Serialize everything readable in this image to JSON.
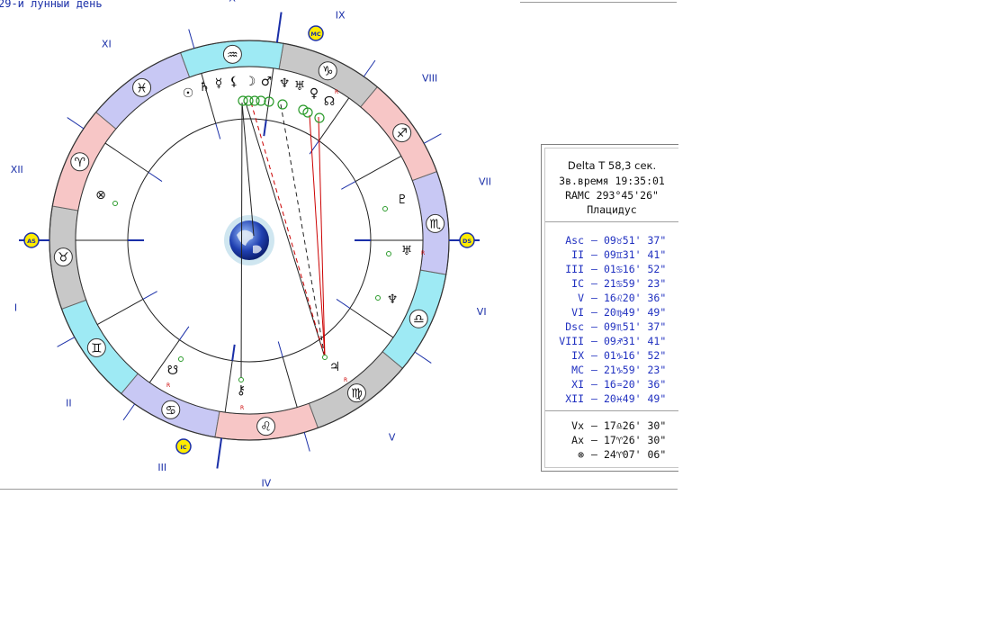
{
  "header": {
    "title": "29-й лунный день"
  },
  "chart": {
    "house_labels": [
      "I",
      "II",
      "III",
      "IV",
      "V",
      "VI",
      "VII",
      "VIII",
      "IX",
      "X",
      "XI",
      "XII"
    ],
    "angle_markers": [
      "AS",
      "IC",
      "DS",
      "MC"
    ],
    "zodiac_glyphs": [
      "♉",
      "♊",
      "♋",
      "♌",
      "♍",
      "♎",
      "♏",
      "♐",
      "♑",
      "♒",
      "♓",
      "♈"
    ],
    "planet_glyphs": {
      "sun": "☉",
      "saturn": "♄",
      "mercury": "☿",
      "lilith": "⚸",
      "moon": "☽",
      "mars": "♂",
      "neptune": "♆",
      "uranus": "♅",
      "venus": "♀",
      "north_node": "☊",
      "pluto": "♇",
      "jupiter": "♃",
      "chiron": "⚷",
      "south_node": "☋",
      "vertex": "⊗"
    },
    "retro_mark": "R",
    "colors": {
      "fire": "#f7c6c6",
      "earth": "#c8c8c8",
      "air": "#9eeaf4",
      "water": "#c8c8f4",
      "line_blue": "#1a2fa8",
      "aspect_red": "#cc0000"
    }
  },
  "panel": {
    "header": [
      "Delta T   58,3 сек.",
      "Зв.время 19:35:01",
      "RAMC 293°45'26\"",
      "Плацидус"
    ],
    "houses": [
      {
        "label": "Asc",
        "deg": "09",
        "sign": "♉",
        "min": "51' 37\""
      },
      {
        "label": "II",
        "deg": "09",
        "sign": "♊",
        "min": "31' 41\""
      },
      {
        "label": "III",
        "deg": "01",
        "sign": "♋",
        "min": "16' 52\""
      },
      {
        "label": "IC",
        "deg": "21",
        "sign": "♋",
        "min": "59' 23\""
      },
      {
        "label": "V",
        "deg": "16",
        "sign": "♌",
        "min": "20' 36\""
      },
      {
        "label": "VI",
        "deg": "20",
        "sign": "♍",
        "min": "49' 49\""
      },
      {
        "label": "Dsc",
        "deg": "09",
        "sign": "♏",
        "min": "51' 37\""
      },
      {
        "label": "VIII",
        "deg": "09",
        "sign": "♐",
        "min": "31' 41\""
      },
      {
        "label": "IX",
        "deg": "01",
        "sign": "♑",
        "min": "16' 52\""
      },
      {
        "label": "MC",
        "deg": "21",
        "sign": "♑",
        "min": "59' 23\""
      },
      {
        "label": "XI",
        "deg": "16",
        "sign": "♒",
        "min": "20' 36\""
      },
      {
        "label": "XII",
        "deg": "20",
        "sign": "♓",
        "min": "49' 49\""
      }
    ],
    "points": [
      {
        "label": "Vx",
        "deg": "17",
        "sign": "♎",
        "min": "26' 30\""
      },
      {
        "label": "Ax",
        "deg": "17",
        "sign": "♈",
        "min": "26' 30\""
      },
      {
        "label": "⊗",
        "deg": "24",
        "sign": "♈",
        "min": "07' 06\""
      }
    ],
    "dash": "–"
  }
}
